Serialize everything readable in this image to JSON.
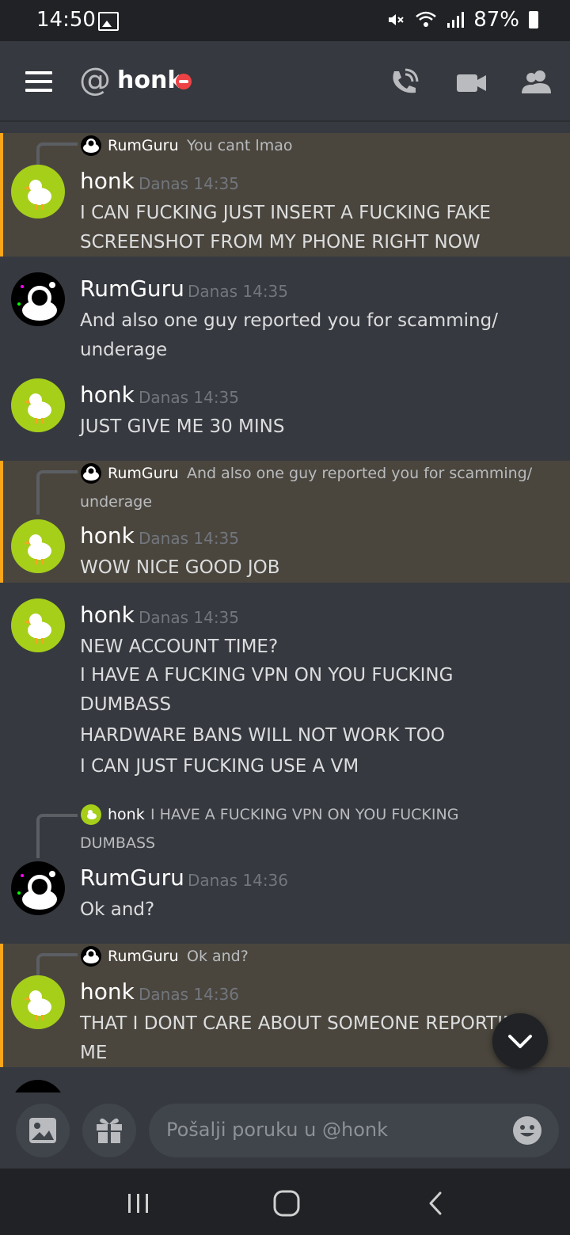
{
  "status_bar": {
    "time": "14:50",
    "battery": "87%"
  },
  "header": {
    "title": "honk"
  },
  "messages": [
    {
      "reply_to_name": "RumGuru",
      "reply_to_text": "You cant lmao",
      "name": "honk",
      "time": "Danas 14:35",
      "lines": [
        "I CAN FUCKING JUST INSERT A FUCKING FAKE",
        "SCREENSHOT FROM MY PHONE RIGHT NOW"
      ]
    },
    {
      "name": "RumGuru",
      "time": "Danas 14:35",
      "lines": [
        "And also one guy reported you for scamming/",
        "underage"
      ]
    },
    {
      "name": "honk",
      "time": "Danas 14:35",
      "lines": [
        "JUST GIVE ME 30 MINS"
      ]
    },
    {
      "reply_to_name": "RumGuru",
      "reply_to_text": "And also one guy reported you for scamming/",
      "reply_to_text2": "underage",
      "name": "honk",
      "time": "Danas 14:35",
      "lines": [
        "WOW NICE GOOD JOB"
      ]
    },
    {
      "name": "honk",
      "time": "Danas 14:35",
      "lines": [
        "NEW ACCOUNT TIME?",
        "I HAVE A FUCKING VPN ON YOU FUCKING",
        "DUMBASS",
        "HARDWARE BANS WILL NOT WORK TOO",
        "I CAN JUST FUCKING USE A VM"
      ]
    },
    {
      "reply_to_name": "honk",
      "reply_to_text": "I HAVE A FUCKING VPN ON YOU FUCKING",
      "reply_to_text2": "DUMBASS",
      "name": "RumGuru",
      "time": "Danas 14:36",
      "lines": [
        "Ok and?"
      ]
    },
    {
      "reply_to_name": "RumGuru",
      "reply_to_text": "Ok and?",
      "name": "honk",
      "time": "Danas 14:36",
      "lines": [
        "THAT I DONT CARE ABOUT SOMEONE REPORTING",
        "ME"
      ]
    }
  ],
  "composer": {
    "placeholder": "Pošalji poruku u @honk"
  },
  "icons": {
    "menu": "hamburger-icon",
    "mention": "at-icon",
    "status": "do-not-disturb-icon",
    "call": "phone-call-icon",
    "video": "video-camera-icon",
    "members": "members-icon",
    "image": "image-icon",
    "gift": "gift-icon",
    "emoji": "emoji-icon",
    "scroll": "chevron-down-icon"
  },
  "colors": {
    "highlight_bg": "#4a463e",
    "highlight_bar": "#faa61a",
    "dnd": "#ed4245",
    "honk_avatar": "#a6cf1a"
  }
}
